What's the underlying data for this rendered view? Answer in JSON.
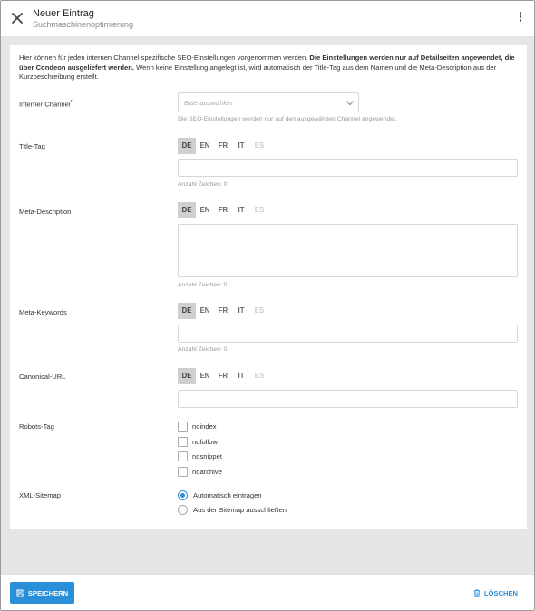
{
  "header": {
    "title": "Neuer Eintrag",
    "subtitle": "Suchmaschinenoptimierung"
  },
  "intro": {
    "text_start": "Hier können für jeden internen Channel spezifische SEO-Einstellungen vorgenommen werden. ",
    "text_bold": "Die Einstellungen werden nur auf Detailseiten angewendet, die über Condeon ausgeliefert werden.",
    "text_end": " Wenn keine Einstellung angelegt ist, wird automatisch der Title-Tag aus dem Namen und die Meta-Description aus der Kurzbeschreibung erstellt."
  },
  "channel": {
    "label": "Interner Channel",
    "required_mark": "*",
    "placeholder": "Bitte auswählen",
    "helper": "Die SEO-Einstellungen werden nur auf den ausgewählten Channel angewendet."
  },
  "languages": [
    "DE",
    "EN",
    "FR",
    "IT",
    "ES"
  ],
  "title_tag": {
    "label": "Title-Tag",
    "counter": "Anzahl Zeichen: 0"
  },
  "meta_description": {
    "label": "Meta-Description",
    "counter": "Anzahl Zeichen: 0"
  },
  "meta_keywords": {
    "label": "Meta-Keywords",
    "counter": "Anzahl Zeichen: 0"
  },
  "canonical": {
    "label": "Canonical-URL"
  },
  "robots": {
    "label": "Robots-Tag",
    "options": [
      "noindex",
      "nofollow",
      "nosnippet",
      "noarchive"
    ]
  },
  "sitemap": {
    "label": "XML-Sitemap",
    "options": [
      "Automatisch eintragen",
      "Aus der Sitemap ausschließen"
    ],
    "selected": "Automatisch eintragen"
  },
  "footer": {
    "save_label": "SPEICHERN",
    "delete_label": "LÖSCHEN"
  },
  "colors": {
    "accent": "#2a8fd9",
    "active_lang": "#cfcfcf",
    "background": "#e6e6e6"
  }
}
